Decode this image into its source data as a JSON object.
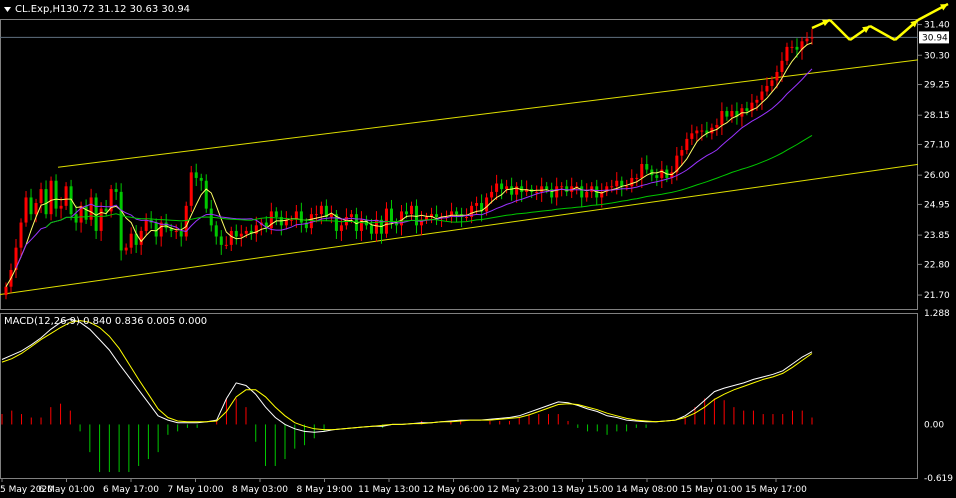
{
  "header": {
    "symbol": "CL.Exp,H1",
    "ohlc": "30.72 31.12 30.63 30.94"
  },
  "macd_label": "MACD(12,26,9) 0.840 0.836 0.005 0.000",
  "colors": {
    "background": "#000000",
    "frame": "#808080",
    "bull": "#FF0000",
    "bear": "#00C800",
    "ma_fast": "#FFFF66",
    "ma_mid": "#9933FF",
    "ma_slow": "#00C800",
    "channel": "#E0E000",
    "forecast": "#FFFF00",
    "macd_line": "#FFFFFF",
    "signal_line": "#FFFF00"
  },
  "chart_data": [
    {
      "type": "candlestick",
      "name": "price",
      "yticks": [
        "31.40",
        "30.30",
        "29.25",
        "28.15",
        "27.10",
        "26.00",
        "24.95",
        "23.85",
        "22.80",
        "21.70"
      ],
      "ylim": [
        21.2,
        31.6
      ],
      "current_price": "30.94",
      "xticks": [
        "5 May 2020",
        "6 May 01:00",
        "6 May 17:00",
        "7 May 10:00",
        "8 May 03:00",
        "8 May 19:00",
        "11 May 13:00",
        "12 May 06:00",
        "12 May 23:00",
        "13 May 15:00",
        "14 May 08:00",
        "15 May 01:00",
        "15 May 17:00"
      ],
      "close": [
        22.0,
        22.6,
        23.4,
        24.3,
        25.2,
        24.6,
        25.0,
        25.5,
        24.6,
        25.8,
        24.8,
        24.9,
        25.6,
        24.6,
        24.3,
        24.9,
        24.4,
        25.2,
        24.0,
        24.8,
        24.7,
        25.5,
        25.4,
        23.3,
        23.4,
        23.9,
        23.5,
        24.0,
        24.4,
        24.3,
        23.8,
        24.3,
        24.1,
        24.0,
        24.0,
        23.8,
        24.9,
        26.1,
        25.9,
        25.8,
        24.8,
        24.2,
        23.8,
        23.5,
        23.5,
        24.0,
        23.8,
        23.9,
        24.0,
        23.9,
        24.2,
        24.3,
        24.1,
        24.7,
        24.5,
        24.2,
        24.4,
        24.4,
        24.7,
        24.3,
        24.1,
        24.6,
        24.6,
        24.9,
        24.5,
        24.6,
        24.0,
        24.2,
        24.5,
        24.6,
        24.0,
        24.4,
        24.2,
        23.9,
        24.4,
        23.9,
        24.8,
        24.3,
        24.2,
        24.7,
        24.6,
        24.9,
        24.2,
        24.4,
        24.5,
        24.6,
        24.5,
        24.5,
        24.5,
        24.7,
        24.6,
        24.5,
        24.5,
        24.9,
        25.0,
        24.7,
        25.2,
        25.4,
        25.7,
        25.5,
        25.6,
        25.3,
        25.6,
        25.4,
        25.5,
        25.4,
        25.4,
        25.6,
        25.5,
        25.2,
        25.6,
        25.6,
        25.4,
        25.6,
        25.6,
        25.2,
        25.4,
        25.6,
        25.2,
        25.4,
        25.6,
        25.6,
        25.8,
        25.6,
        25.6,
        25.9,
        25.9,
        26.4,
        26.2,
        26.0,
        25.9,
        26.2,
        25.9,
        26.1,
        26.7,
        26.9,
        27.3,
        27.5,
        27.6,
        27.6,
        27.5,
        27.7,
        27.8,
        28.3,
        28.1,
        28.3,
        28.1,
        28.4,
        28.3,
        28.6,
        28.7,
        29.0,
        29.2,
        29.4,
        29.7,
        30.1,
        30.6,
        30.6,
        30.5,
        30.8,
        30.9,
        30.94
      ],
      "overlays": [
        "MA fast (yellow)",
        "MA mid (purple)",
        "MA slow (green)"
      ],
      "channel": {
        "upper": [
          [
            0,
            26.05
          ],
          [
            165,
            29.75
          ]
        ],
        "lower": [
          [
            0,
            21.75
          ],
          [
            165,
            25.95
          ]
        ]
      },
      "forecast_arrows": "zigzag up"
    },
    {
      "type": "macd",
      "name": "MACD(12,26,9)",
      "yticks": [
        "1.288",
        "0.00",
        "-0.619"
      ],
      "ylim": [
        -0.619,
        1.288
      ],
      "macd": [
        0.75,
        0.8,
        0.85,
        0.92,
        1.0,
        1.1,
        1.18,
        1.22,
        1.18,
        1.1,
        0.98,
        0.86,
        0.7,
        0.55,
        0.4,
        0.25,
        0.1,
        0.05,
        0.02,
        0.02,
        0.02,
        0.03,
        0.05,
        0.3,
        0.48,
        0.45,
        0.35,
        0.2,
        0.08,
        0.0,
        -0.05,
        -0.08,
        -0.09,
        -0.08,
        -0.06,
        -0.05,
        -0.04,
        -0.03,
        -0.02,
        -0.02,
        0.0,
        0.0,
        0.01,
        0.02,
        0.02,
        0.03,
        0.04,
        0.05,
        0.05,
        0.05,
        0.06,
        0.07,
        0.08,
        0.1,
        0.14,
        0.18,
        0.22,
        0.26,
        0.25,
        0.22,
        0.18,
        0.15,
        0.1,
        0.08,
        0.05,
        0.04,
        0.03,
        0.03,
        0.04,
        0.05,
        0.1,
        0.18,
        0.28,
        0.38,
        0.42,
        0.45,
        0.48,
        0.52,
        0.55,
        0.58,
        0.62,
        0.7,
        0.78,
        0.84
      ],
      "signal": [
        0.72,
        0.76,
        0.82,
        0.9,
        0.98,
        1.05,
        1.12,
        1.18,
        1.2,
        1.18,
        1.12,
        1.02,
        0.88,
        0.7,
        0.52,
        0.35,
        0.18,
        0.08,
        0.04,
        0.03,
        0.03,
        0.03,
        0.04,
        0.15,
        0.32,
        0.4,
        0.4,
        0.32,
        0.2,
        0.1,
        0.02,
        -0.02,
        -0.05,
        -0.06,
        -0.06,
        -0.05,
        -0.04,
        -0.03,
        -0.02,
        -0.01,
        0.0,
        0.0,
        0.01,
        0.01,
        0.02,
        0.03,
        0.03,
        0.04,
        0.05,
        0.05,
        0.05,
        0.06,
        0.07,
        0.08,
        0.11,
        0.15,
        0.19,
        0.23,
        0.24,
        0.23,
        0.2,
        0.17,
        0.13,
        0.1,
        0.07,
        0.05,
        0.04,
        0.03,
        0.04,
        0.05,
        0.08,
        0.13,
        0.2,
        0.29,
        0.35,
        0.4,
        0.44,
        0.48,
        0.52,
        0.55,
        0.59,
        0.66,
        0.74,
        0.82
      ]
    }
  ]
}
